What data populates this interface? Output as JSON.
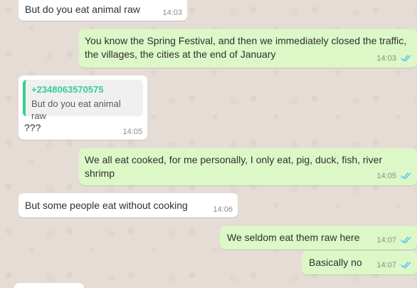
{
  "chat": {
    "messages": [
      {
        "text": "But do you eat animal raw",
        "time": "14:03"
      },
      {
        "text": "You know the Spring Festival, and then we immediately closed the traffic, the villages, the cities at the end of January",
        "time": "14:03"
      },
      {
        "quote_author": "+2348063570575",
        "quote_text": "But do you eat animal raw",
        "text": "???",
        "time": "14:05"
      },
      {
        "text": "We all eat cooked, for me personally, I only eat, pig, duck, fish, river shrimp",
        "time": "14:05"
      },
      {
        "text": "But some people eat without cooking",
        "time": "14:06"
      },
      {
        "text": "We seldom eat them raw here",
        "time": "14:07"
      },
      {
        "text": "Basically no",
        "time": "14:07"
      }
    ],
    "colors": {
      "background": "#e5ddd5",
      "incoming_bubble": "#ffffff",
      "outgoing_bubble": "#dcf8c6",
      "quote_accent": "#35cd96",
      "read_ticks": "#4fc3f7",
      "timestamp": "#8c8c8c"
    },
    "icons": {
      "read_receipt": "double-check-icon"
    }
  }
}
